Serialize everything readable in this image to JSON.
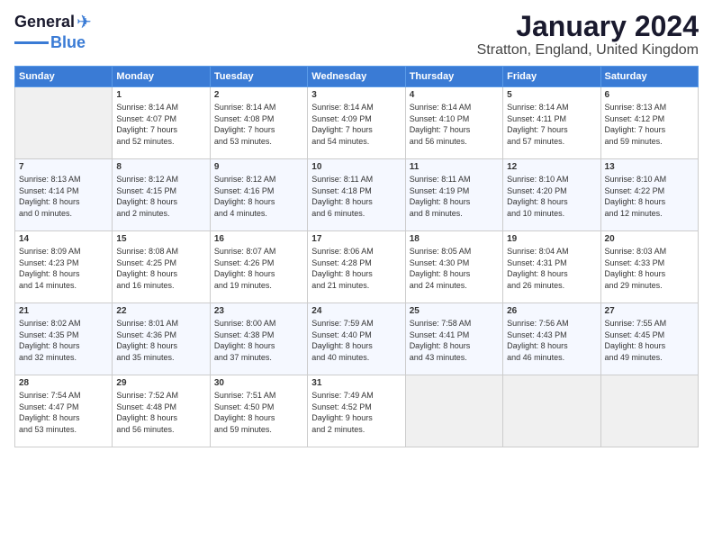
{
  "logo": {
    "line1": "General",
    "line2": "Blue"
  },
  "title": "January 2024",
  "location": "Stratton, England, United Kingdom",
  "days_of_week": [
    "Sunday",
    "Monday",
    "Tuesday",
    "Wednesday",
    "Thursday",
    "Friday",
    "Saturday"
  ],
  "weeks": [
    [
      {
        "day": "",
        "info": ""
      },
      {
        "day": "1",
        "info": "Sunrise: 8:14 AM\nSunset: 4:07 PM\nDaylight: 7 hours\nand 52 minutes."
      },
      {
        "day": "2",
        "info": "Sunrise: 8:14 AM\nSunset: 4:08 PM\nDaylight: 7 hours\nand 53 minutes."
      },
      {
        "day": "3",
        "info": "Sunrise: 8:14 AM\nSunset: 4:09 PM\nDaylight: 7 hours\nand 54 minutes."
      },
      {
        "day": "4",
        "info": "Sunrise: 8:14 AM\nSunset: 4:10 PM\nDaylight: 7 hours\nand 56 minutes."
      },
      {
        "day": "5",
        "info": "Sunrise: 8:14 AM\nSunset: 4:11 PM\nDaylight: 7 hours\nand 57 minutes."
      },
      {
        "day": "6",
        "info": "Sunrise: 8:13 AM\nSunset: 4:12 PM\nDaylight: 7 hours\nand 59 minutes."
      }
    ],
    [
      {
        "day": "7",
        "info": "Sunrise: 8:13 AM\nSunset: 4:14 PM\nDaylight: 8 hours\nand 0 minutes."
      },
      {
        "day": "8",
        "info": "Sunrise: 8:12 AM\nSunset: 4:15 PM\nDaylight: 8 hours\nand 2 minutes."
      },
      {
        "day": "9",
        "info": "Sunrise: 8:12 AM\nSunset: 4:16 PM\nDaylight: 8 hours\nand 4 minutes."
      },
      {
        "day": "10",
        "info": "Sunrise: 8:11 AM\nSunset: 4:18 PM\nDaylight: 8 hours\nand 6 minutes."
      },
      {
        "day": "11",
        "info": "Sunrise: 8:11 AM\nSunset: 4:19 PM\nDaylight: 8 hours\nand 8 minutes."
      },
      {
        "day": "12",
        "info": "Sunrise: 8:10 AM\nSunset: 4:20 PM\nDaylight: 8 hours\nand 10 minutes."
      },
      {
        "day": "13",
        "info": "Sunrise: 8:10 AM\nSunset: 4:22 PM\nDaylight: 8 hours\nand 12 minutes."
      }
    ],
    [
      {
        "day": "14",
        "info": "Sunrise: 8:09 AM\nSunset: 4:23 PM\nDaylight: 8 hours\nand 14 minutes."
      },
      {
        "day": "15",
        "info": "Sunrise: 8:08 AM\nSunset: 4:25 PM\nDaylight: 8 hours\nand 16 minutes."
      },
      {
        "day": "16",
        "info": "Sunrise: 8:07 AM\nSunset: 4:26 PM\nDaylight: 8 hours\nand 19 minutes."
      },
      {
        "day": "17",
        "info": "Sunrise: 8:06 AM\nSunset: 4:28 PM\nDaylight: 8 hours\nand 21 minutes."
      },
      {
        "day": "18",
        "info": "Sunrise: 8:05 AM\nSunset: 4:30 PM\nDaylight: 8 hours\nand 24 minutes."
      },
      {
        "day": "19",
        "info": "Sunrise: 8:04 AM\nSunset: 4:31 PM\nDaylight: 8 hours\nand 26 minutes."
      },
      {
        "day": "20",
        "info": "Sunrise: 8:03 AM\nSunset: 4:33 PM\nDaylight: 8 hours\nand 29 minutes."
      }
    ],
    [
      {
        "day": "21",
        "info": "Sunrise: 8:02 AM\nSunset: 4:35 PM\nDaylight: 8 hours\nand 32 minutes."
      },
      {
        "day": "22",
        "info": "Sunrise: 8:01 AM\nSunset: 4:36 PM\nDaylight: 8 hours\nand 35 minutes."
      },
      {
        "day": "23",
        "info": "Sunrise: 8:00 AM\nSunset: 4:38 PM\nDaylight: 8 hours\nand 37 minutes."
      },
      {
        "day": "24",
        "info": "Sunrise: 7:59 AM\nSunset: 4:40 PM\nDaylight: 8 hours\nand 40 minutes."
      },
      {
        "day": "25",
        "info": "Sunrise: 7:58 AM\nSunset: 4:41 PM\nDaylight: 8 hours\nand 43 minutes."
      },
      {
        "day": "26",
        "info": "Sunrise: 7:56 AM\nSunset: 4:43 PM\nDaylight: 8 hours\nand 46 minutes."
      },
      {
        "day": "27",
        "info": "Sunrise: 7:55 AM\nSunset: 4:45 PM\nDaylight: 8 hours\nand 49 minutes."
      }
    ],
    [
      {
        "day": "28",
        "info": "Sunrise: 7:54 AM\nSunset: 4:47 PM\nDaylight: 8 hours\nand 53 minutes."
      },
      {
        "day": "29",
        "info": "Sunrise: 7:52 AM\nSunset: 4:48 PM\nDaylight: 8 hours\nand 56 minutes."
      },
      {
        "day": "30",
        "info": "Sunrise: 7:51 AM\nSunset: 4:50 PM\nDaylight: 8 hours\nand 59 minutes."
      },
      {
        "day": "31",
        "info": "Sunrise: 7:49 AM\nSunset: 4:52 PM\nDaylight: 9 hours\nand 2 minutes."
      },
      {
        "day": "",
        "info": ""
      },
      {
        "day": "",
        "info": ""
      },
      {
        "day": "",
        "info": ""
      }
    ]
  ]
}
